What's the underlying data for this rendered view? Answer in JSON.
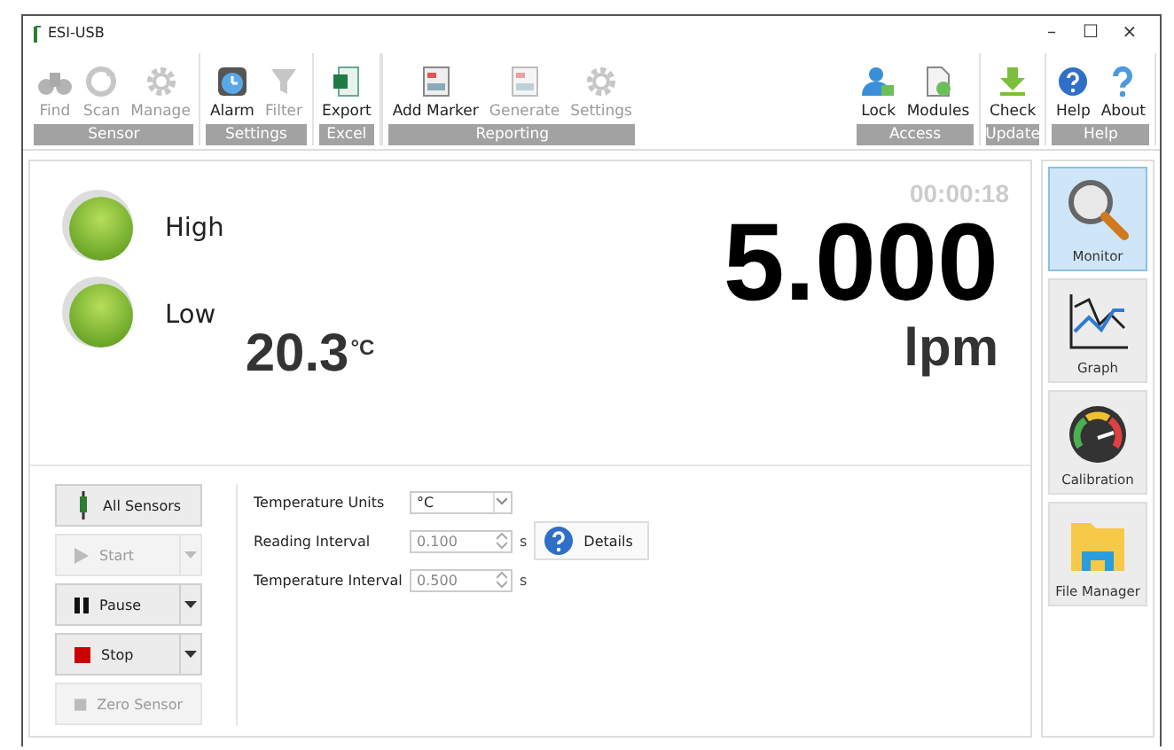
{
  "window": {
    "title": "ESI-USB",
    "controls": [
      "–",
      "☐",
      "×"
    ]
  },
  "ribbon": [
    {
      "label": "Sensor",
      "items": [
        {
          "label": "Find",
          "disabled": true
        },
        {
          "label": "Scan",
          "disabled": true
        },
        {
          "label": "Manage",
          "disabled": true
        }
      ]
    },
    {
      "label": "Settings",
      "items": [
        {
          "label": "Alarm",
          "disabled": false
        },
        {
          "label": "Filter",
          "disabled": true
        }
      ]
    },
    {
      "label": "Excel",
      "items": [
        {
          "label": "Export",
          "disabled": false
        }
      ]
    },
    {
      "label": "Reporting",
      "items": [
        {
          "label": "Add Marker",
          "disabled": false
        },
        {
          "label": "Generate",
          "disabled": true
        },
        {
          "label": "Settings",
          "disabled": true
        }
      ]
    },
    {
      "label": "Access",
      "items": [
        {
          "label": "Lock",
          "disabled": false
        },
        {
          "label": "Modules",
          "disabled": false
        }
      ]
    },
    {
      "label": "Update",
      "items": [
        {
          "label": "Check",
          "disabled": false
        }
      ]
    },
    {
      "label": "Help",
      "items": [
        {
          "label": "Help",
          "disabled": false
        },
        {
          "label": "About",
          "disabled": false
        }
      ]
    }
  ],
  "monitor": {
    "alarms": [
      {
        "label": "High",
        "on": true
      },
      {
        "label": "Low",
        "on": true
      }
    ],
    "timer": "00:00:18",
    "reading": {
      "value": "5.000",
      "unit": "lpm"
    },
    "temperature": {
      "value": "20.3",
      "unit": "°C"
    }
  },
  "actions": [
    {
      "label": "All Sensors",
      "kind": "plain",
      "disabled": false
    },
    {
      "label": "Start",
      "kind": "split",
      "disabled": true
    },
    {
      "label": "Pause",
      "kind": "split",
      "disabled": false
    },
    {
      "label": "Stop",
      "kind": "split",
      "disabled": false
    },
    {
      "label": "Zero Sensor",
      "kind": "plain",
      "disabled": true
    }
  ],
  "settings": [
    {
      "label": "Temperature Units",
      "kind": "select",
      "value": "°C",
      "disabled": false
    },
    {
      "label": "Reading Interval",
      "kind": "spin",
      "value": "0.100",
      "unit": "s",
      "disabled": true,
      "button": "Details"
    },
    {
      "label": "Temperature Interval",
      "kind": "spin",
      "value": "0.500",
      "unit": "s",
      "disabled": true
    }
  ],
  "sidebar": [
    {
      "label": "Monitor",
      "selected": true
    },
    {
      "label": "Graph",
      "selected": false
    },
    {
      "label": "Calibration",
      "selected": false
    },
    {
      "label": "File Manager",
      "selected": false
    }
  ]
}
